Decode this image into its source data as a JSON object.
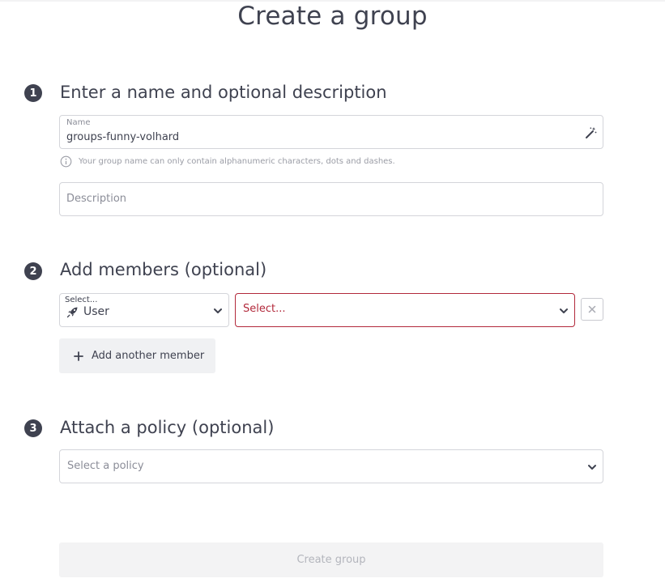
{
  "page": {
    "title": "Create a group"
  },
  "steps": [
    {
      "number": "1",
      "title": "Enter a name and optional description"
    },
    {
      "number": "2",
      "title": "Add members (optional)"
    },
    {
      "number": "3",
      "title": "Attach a policy (optional)"
    }
  ],
  "name_field": {
    "label": "Name",
    "value": "groups-funny-volhard",
    "hint": "Your group name can only contain alphanumeric characters, dots and dashes.",
    "generate_icon": "magic-wand-icon"
  },
  "description_field": {
    "placeholder": "Description"
  },
  "members": {
    "type_select": {
      "label": "Select...",
      "value": "User",
      "icon": "rocket-icon"
    },
    "member_select": {
      "placeholder": "Select..."
    },
    "add_label": "Add another member"
  },
  "policy_select": {
    "placeholder": "Select a policy"
  },
  "submit": {
    "label": "Create group"
  },
  "colors": {
    "text": "#3f4250",
    "error_border": "#b2293b",
    "error_text": "#b2293b",
    "disabled_bg": "#f3f3f4",
    "disabled_text": "#b3b5bc"
  }
}
